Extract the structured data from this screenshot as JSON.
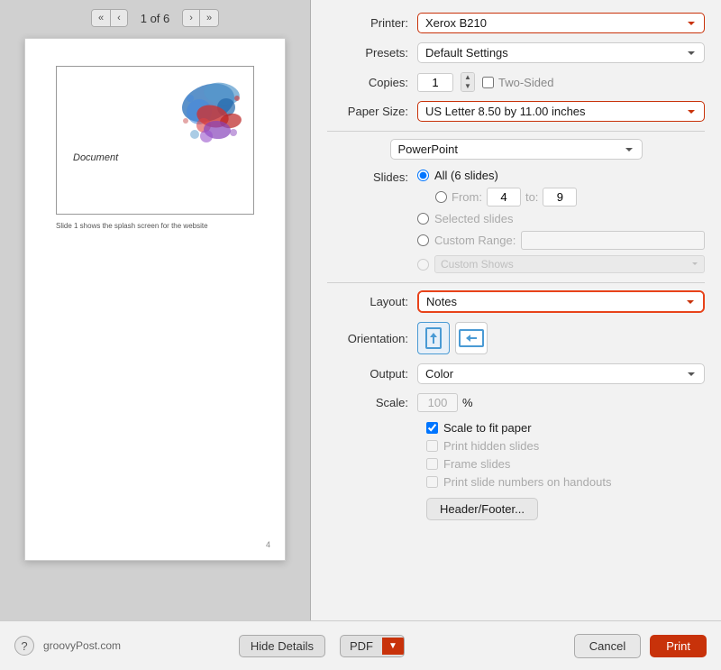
{
  "header": {
    "page_current": "1",
    "page_total": "6",
    "page_indicator": "1 of 6"
  },
  "preview": {
    "slide_label": "Document",
    "slide_caption": "Slide 1 shows the splash screen for the website",
    "page_number": "4"
  },
  "print": {
    "printer_label": "Printer:",
    "printer_value": "Xerox B210",
    "presets_label": "Presets:",
    "presets_value": "Default Settings",
    "copies_label": "Copies:",
    "copies_value": "1",
    "two_sided_label": "Two-Sided",
    "paper_size_label": "Paper Size:",
    "paper_size_value": "US Letter 8.50 by 11.00 inches",
    "powerpoint_value": "PowerPoint",
    "slides_label": "Slides:",
    "slides_all_label": "All  (6 slides)",
    "slides_from_label": "From:",
    "slides_from_value": "4",
    "slides_to_label": "to:",
    "slides_to_value": "9",
    "slides_selected_label": "Selected slides",
    "slides_custom_range_label": "Custom Range:",
    "slides_custom_shows_label": "Custom Shows",
    "layout_label": "Layout:",
    "layout_value": "Notes",
    "orientation_label": "Orientation:",
    "output_label": "Output:",
    "output_value": "Color",
    "scale_label": "Scale:",
    "scale_value": "100",
    "scale_unit": "%",
    "scale_to_fit_label": "Scale to fit paper",
    "print_hidden_label": "Print hidden slides",
    "frame_slides_label": "Frame slides",
    "print_slide_numbers_label": "Print slide numbers on handouts",
    "header_footer_btn": "Header/Footer..."
  },
  "footer": {
    "help_label": "?",
    "site_text": "groovyPost.com",
    "hide_details_btn": "Hide Details",
    "pdf_label": "PDF",
    "cancel_label": "Cancel",
    "print_label": "Print"
  }
}
